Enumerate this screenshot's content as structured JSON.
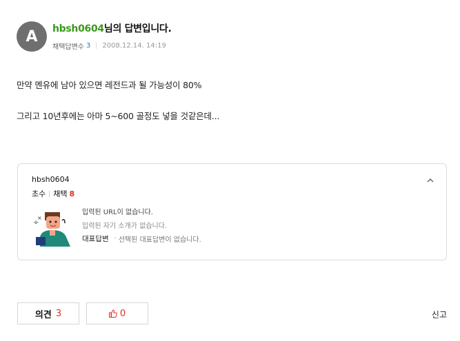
{
  "answer": {
    "avatar_letter": "A",
    "author": "hbsh0604",
    "title_suffix": "님의 답변입니다.",
    "adopted_label": "채택답변수",
    "adopted_count": "3",
    "date": "2008.12.14. 14:19",
    "lines": [
      "만약 멘유에 남아 있으면 레전드과 될 가능성이 80%",
      "그리고 10년후에는 아마 5~600 골정도 넣을 것같은데..."
    ]
  },
  "profile": {
    "name": "hbsh0604",
    "grade": "초수",
    "adopt_label": "채택",
    "adopt_count": "8",
    "url_text": "입력된 URL이 없습니다.",
    "intro_text": "입력된 자기 소개가 없습니다.",
    "rep_label": "대표답변",
    "rep_text": "선택된 대표답변이 없습니다.",
    "chevron_icon": "chevron-up-icon"
  },
  "actions": {
    "opinion_label": "의견",
    "opinion_count": "3",
    "like_icon": "thumbs-up-icon",
    "like_count": "0",
    "report_label": "신고"
  },
  "colors": {
    "author": "#3a9a1a",
    "accent_red": "#e0301e",
    "count_blue": "#2a6fd6"
  }
}
